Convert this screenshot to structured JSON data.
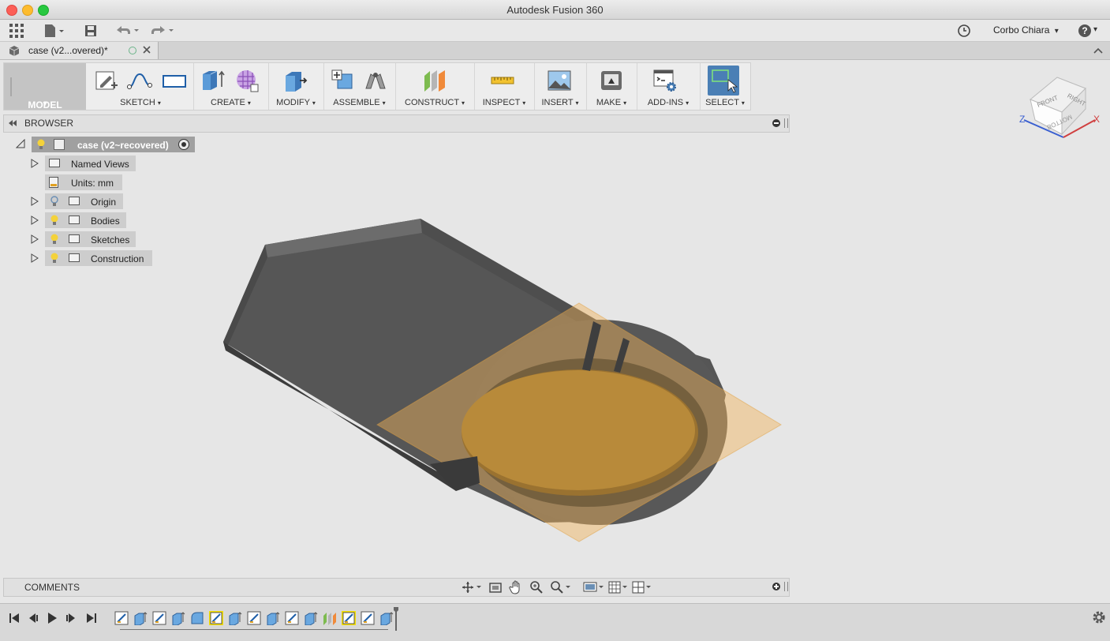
{
  "window": {
    "title": "Autodesk Fusion 360"
  },
  "top_toolbar": {
    "user": "Corbo Chiara",
    "user_caret": "▾",
    "help_caret": "▾"
  },
  "document_tab": {
    "label": "case (v2...overed)*"
  },
  "ribbon": {
    "workspace": "MODEL",
    "groups": [
      {
        "label": "SKETCH"
      },
      {
        "label": "CREATE"
      },
      {
        "label": "MODIFY"
      },
      {
        "label": "ASSEMBLE"
      },
      {
        "label": "CONSTRUCT"
      },
      {
        "label": "INSPECT"
      },
      {
        "label": "INSERT"
      },
      {
        "label": "MAKE"
      },
      {
        "label": "ADD-INS"
      },
      {
        "label": "SELECT"
      }
    ],
    "caret": "▾"
  },
  "browser": {
    "title": "BROWSER",
    "root": "case (v2~recovered)",
    "items": [
      {
        "label": "Named Views"
      },
      {
        "label": "Units: mm"
      },
      {
        "label": "Origin"
      },
      {
        "label": "Bodies"
      },
      {
        "label": "Sketches"
      },
      {
        "label": "Construction"
      }
    ]
  },
  "viewcube": {
    "front": "FRONT",
    "right": "RIGHT",
    "bottom": "BOTTOM",
    "axis_z": "Z",
    "axis_x": "X"
  },
  "comments": {
    "title": "COMMENTS"
  },
  "colors": {
    "accent_select": "#4a7fb5",
    "plane": "#f2b35a",
    "body": "#545454"
  }
}
